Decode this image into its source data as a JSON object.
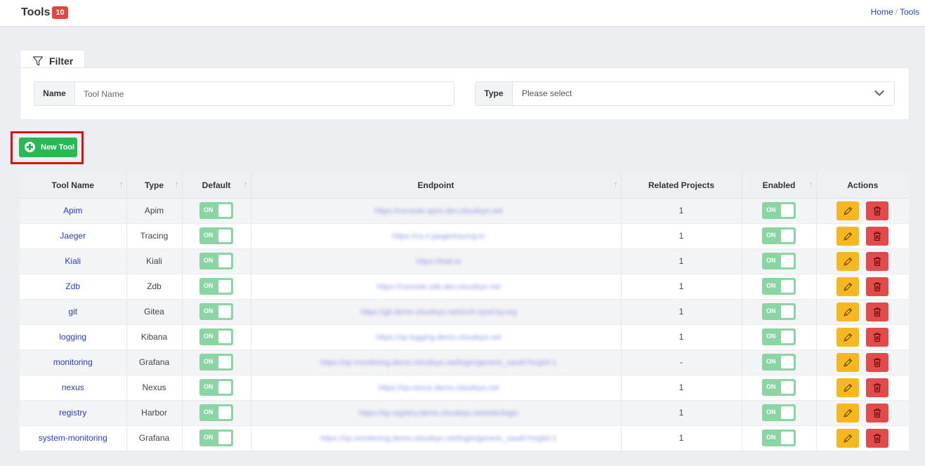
{
  "header": {
    "title": "Tools",
    "count": "10"
  },
  "breadcrumb": {
    "home": "Home",
    "separator": "/",
    "current": "Tools"
  },
  "filter": {
    "tab_label": "Filter",
    "name_label": "Name",
    "name_placeholder": "Tool Name",
    "type_label": "Type",
    "type_selected": "Please select"
  },
  "new_tool_label": "New Tool",
  "table": {
    "columns": {
      "tool_name": "Tool Name",
      "type": "Type",
      "default": "Default",
      "endpoint": "Endpoint",
      "related_projects": "Related Projects",
      "enabled": "Enabled",
      "actions": "Actions"
    },
    "toggle_label": "ON",
    "rows": [
      {
        "name": "Apim",
        "type": "Apim",
        "default": true,
        "endpoint": "https://console.apim.dev.cloudsys.net",
        "related": "1",
        "enabled": true
      },
      {
        "name": "Jaeger",
        "type": "Tracing",
        "default": true,
        "endpoint": "https://cs.n.jaegertracing.io",
        "related": "1",
        "enabled": true
      },
      {
        "name": "Kiali",
        "type": "Kiali",
        "default": true,
        "endpoint": "https://kiali.io",
        "related": "1",
        "enabled": true
      },
      {
        "name": "Zdb",
        "type": "Zdb",
        "default": true,
        "endpoint": "https://console.zdb.dev.cloudsys.net",
        "related": "1",
        "enabled": true
      },
      {
        "name": "git",
        "type": "Gitea",
        "default": true,
        "endpoint": "https://git.demo.cloudsys.net/orch.sysd.by.org",
        "related": "1",
        "enabled": true
      },
      {
        "name": "logging",
        "type": "Kibana",
        "default": true,
        "endpoint": "https://sp.logging.demo.cloudsys.net",
        "related": "1",
        "enabled": true
      },
      {
        "name": "monitoring",
        "type": "Grafana",
        "default": true,
        "endpoint": "https://sp.monitoring.demo.cloudsys.net/login/generic_oauth?orgId=1",
        "related": "-",
        "enabled": true
      },
      {
        "name": "nexus",
        "type": "Nexus",
        "default": true,
        "endpoint": "https://sp.nexus.demo.cloudsys.net",
        "related": "1",
        "enabled": true
      },
      {
        "name": "registry",
        "type": "Harbor",
        "default": true,
        "endpoint": "https://sp.registry.demo.cloudsys.net/oidc/login",
        "related": "1",
        "enabled": true
      },
      {
        "name": "system-monitoring",
        "type": "Grafana",
        "default": true,
        "endpoint": "https://sp.monitoring.demo.cloudsys.net/login/generic_oauth?orgId=1",
        "related": "1",
        "enabled": true
      }
    ]
  },
  "colors": {
    "new_tool_button": "#28b955",
    "badge": "#e0483e",
    "toggle_on": "#8ad5a3",
    "edit_button": "#f7b71f",
    "delete_button": "#e24b4b",
    "link": "#2a3bbf",
    "highlight": "#e00f0f"
  },
  "icons": {
    "filter": "filter-icon",
    "chevron": "chevron-down-icon",
    "plus": "plus-circle-icon",
    "sort": "sort-arrow-icon",
    "edit": "pencil-icon",
    "delete": "trash-icon"
  }
}
